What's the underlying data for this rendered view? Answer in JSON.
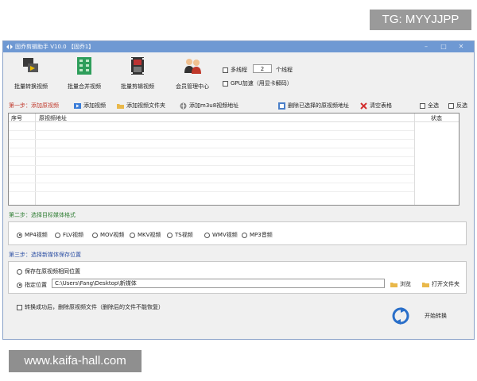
{
  "watermarks": {
    "top": "TG: MYYJJPP",
    "bottom": "www.kaifa-hall.com"
  },
  "window": {
    "title": "固乔剪辑助手 V10.0  【固乔1】"
  },
  "toolbar": [
    {
      "label": "批量转换视频",
      "icon": "convert-video-icon"
    },
    {
      "label": "批量合并视频",
      "icon": "merge-video-icon"
    },
    {
      "label": "批量剪辑视频",
      "icon": "film-edit-icon"
    },
    {
      "label": "会员管理中心",
      "icon": "members-icon"
    }
  ],
  "options": {
    "multithread_label": "多线程",
    "thread_count": "2",
    "thread_unit": "个线程",
    "gpu_label": "GPU加速（用显卡解码）"
  },
  "step1": {
    "title": "第一步：添加原视频",
    "actions": {
      "add_video": "添加视频",
      "add_folder": "添加视频文件夹",
      "add_m3u8": "添加m3u8视频地址",
      "delete_selected": "删除已选择的原视频地址",
      "clear_table": "清空表格",
      "select_all": "全选",
      "invert": "反选"
    },
    "columns": {
      "index": "序号",
      "path": "原视频地址",
      "status": "状态"
    }
  },
  "step2": {
    "title": "第二步：选择目标媒体格式",
    "formats": [
      "MP4视频",
      "FLV视频",
      "MOV视频",
      "MKV视频",
      "TS视频",
      "WMV视频",
      "MP3音频"
    ],
    "selected": "MP4视频"
  },
  "step3": {
    "title": "第三步：选择新媒体保存位置",
    "same_location": "保存在原视频相同位置",
    "custom_location": "指定位置",
    "path": "C:\\Users\\Fang\\Desktop\\新媒体",
    "browse": "浏览",
    "open_folder": "打开文件夹"
  },
  "footer": {
    "delete_after": "转换成功后，删除原视频文件（删除后的文件不能恢复）",
    "start": "开始转换"
  },
  "colors": {
    "titlebar": "#6f99d3",
    "step1": "#c0392b",
    "step2": "#2e7d32",
    "step3": "#2c4fa3"
  }
}
